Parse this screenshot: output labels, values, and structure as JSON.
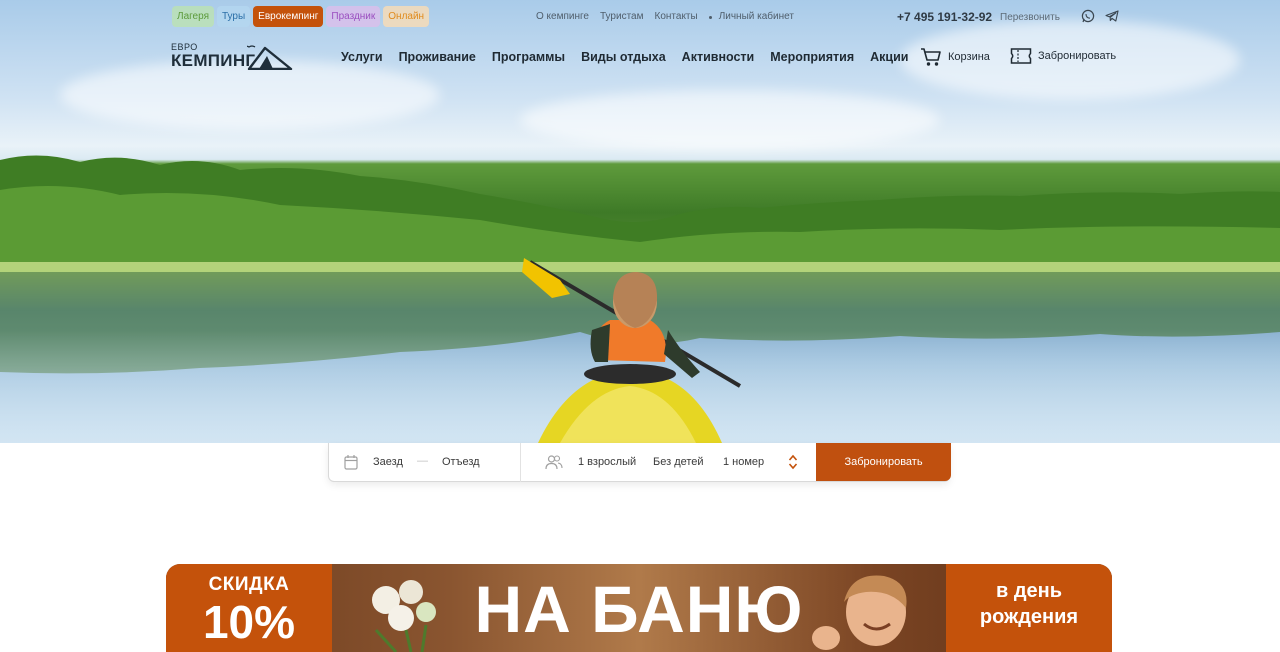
{
  "header": {
    "tags": [
      "Лагеря",
      "Туры",
      "Еврокемпинг",
      "Праздник",
      "Онлайн"
    ],
    "top_links": [
      "О кемпинге",
      "Туристам",
      "Контакты",
      "Личный кабинет"
    ],
    "phone": "+7 495 191-32-92",
    "callback": "Перезвонить",
    "social_icons": [
      "whatsapp-icon",
      "telegram-icon"
    ]
  },
  "logo": {
    "line1": "ЕВРО",
    "line2": "КЕМПИНГ"
  },
  "nav": {
    "items": [
      "Услуги",
      "Проживание",
      "Программы",
      "Виды отдыха",
      "Активности",
      "Мероприятия",
      "Акции"
    ],
    "cart": "Корзина",
    "book": "Забронировать"
  },
  "booking": {
    "check_in": "Заезд",
    "check_out": "Отъезд",
    "dash": "—",
    "adults": "1 взрослый",
    "children": "Без детей",
    "rooms": "1 номер",
    "button": "Забронировать"
  },
  "promo": {
    "left_line1": "СКИДКА",
    "left_line2": "10%",
    "main": "НА БАНЮ",
    "right_line1": "в день",
    "right_line2": "рождения"
  },
  "colors": {
    "accent": "#c4520b",
    "text_dark": "#1f2a33"
  }
}
